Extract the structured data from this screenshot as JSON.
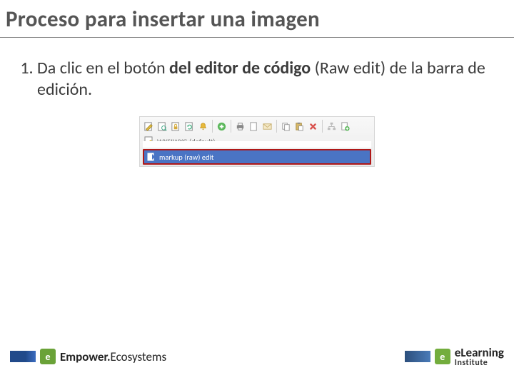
{
  "title": "Proceso para insertar una imagen",
  "step": {
    "number": "1.",
    "pre": "Da clic en el botón ",
    "bold": "del editor de código",
    "post": " (Raw edit) de la barra de edición."
  },
  "toolbar": {
    "icons": [
      "edit-page-icon",
      "view-icon",
      "lock-icon",
      "refresh-icon",
      "bell-icon",
      "sep",
      "add-icon",
      "sep",
      "print-icon",
      "pdf-icon",
      "email-icon",
      "sep",
      "copy-icon",
      "paste-icon",
      "delete-icon",
      "sep",
      "tree-icon",
      "new-page-icon"
    ],
    "dd_wysiwyg": "WYSIWYG (default)",
    "dd_markup": "markup (raw) edit"
  },
  "footer": {
    "left_brand_bold": "Empower.",
    "left_brand_rest": "Ecosystems",
    "left_logo_letter": "e",
    "right_brand_bold1": "e",
    "right_brand_rest": "Learning",
    "right_sub": "Institute",
    "right_logo_letter": "e"
  }
}
